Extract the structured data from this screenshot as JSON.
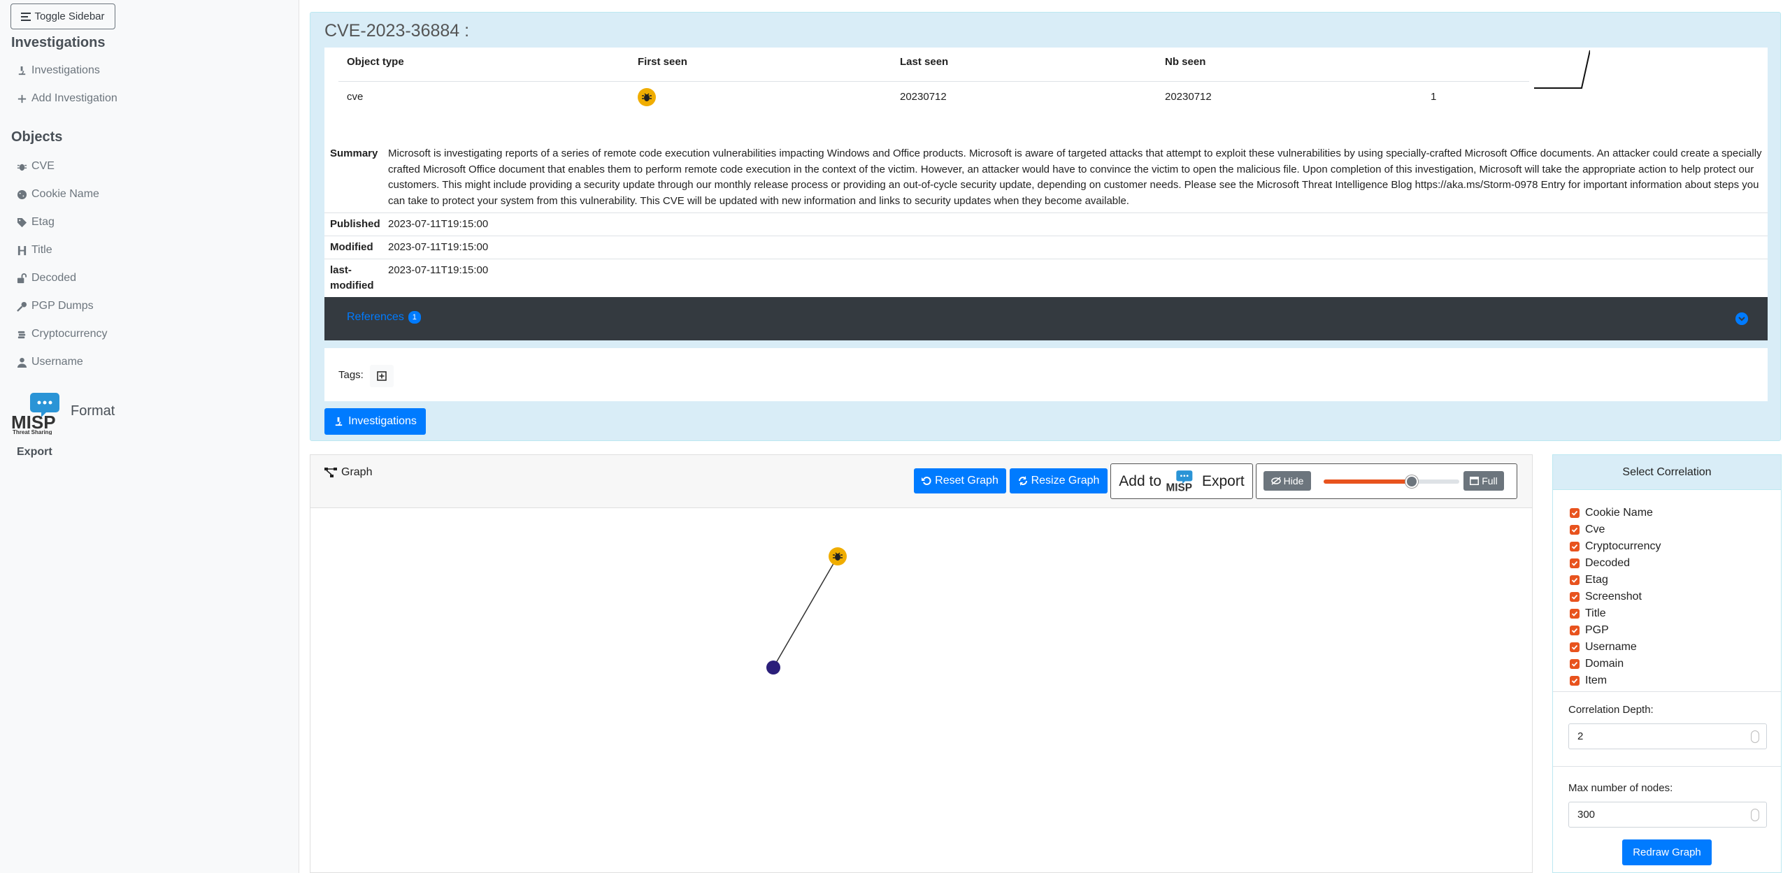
{
  "sidebar": {
    "toggle_label": "Toggle Sidebar",
    "investigations_heading": "Investigations",
    "investigations_link": "Investigations",
    "add_investigation_link": "Add Investigation",
    "objects_heading": "Objects",
    "objects": [
      "CVE",
      "Cookie Name",
      "Etag",
      "Title",
      "Decoded",
      "PGP Dumps",
      "Cryptocurrency",
      "Username"
    ],
    "misp_text": "MISP",
    "misp_sub": "Threat Sharing",
    "format_label": "Format",
    "export_label": "Export"
  },
  "cve": {
    "title": "CVE-2023-36884 :",
    "headers": [
      "Object type",
      "First seen",
      "Last seen",
      "Nb seen"
    ],
    "row": {
      "type": "cve",
      "first_seen": "20230712",
      "last_seen": "20230712",
      "nb_seen": "1"
    },
    "summary_label": "Summary",
    "summary": "Microsoft is investigating reports of a series of remote code execution vulnerabilities impacting Windows and Office products. Microsoft is aware of targeted attacks that attempt to exploit these vulnerabilities by using specially-crafted Microsoft Office documents. An attacker could create a specially crafted Microsoft Office document that enables them to perform remote code execution in the context of the victim. However, an attacker would have to convince the victim to open the malicious file. Upon completion of this investigation, Microsoft will take the appropriate action to help protect our customers. This might include providing a security update through our monthly release process or providing an out-of-cycle security update, depending on customer needs. Please see the Microsoft Threat Intelligence Blog https://aka.ms/Storm-0978  Entry for important information about steps you can take to protect your system from this vulnerability. This CVE will be updated with new information and links to security updates when they become available.",
    "published_label": "Published",
    "published": "2023-07-11T19:15:00",
    "modified_label": "Modified",
    "modified": "2023-07-11T19:15:00",
    "last_modified_label_1": "last-",
    "last_modified_label_2": "modified",
    "last_modified": "2023-07-11T19:15:00",
    "references_label": "References",
    "references_count": "1",
    "tags_label": "Tags:",
    "investigations_button": "Investigations"
  },
  "graph": {
    "title": "Graph",
    "reset_button": "Reset Graph",
    "resize_button": "Resize Graph",
    "add_to_label": "Add to",
    "export_label": "Export",
    "misp_text": "MISP",
    "hide_button": "Hide",
    "full_button": "Full",
    "slider_value": 0.65,
    "node_colors": {
      "cve": "#f0ad00",
      "root": "#2b1f7a"
    }
  },
  "correlation": {
    "title": "Select Correlation",
    "items": [
      "Cookie Name",
      "Cve",
      "Cryptocurrency",
      "Decoded",
      "Etag",
      "Screenshot",
      "Title",
      "PGP",
      "Username",
      "Domain",
      "Item"
    ],
    "depth_label": "Correlation Depth:",
    "depth_value": "2",
    "max_nodes_label": "Max number of nodes:",
    "max_nodes_value": "300",
    "redraw_button": "Redraw Graph"
  },
  "colors": {
    "primary": "#007bff",
    "accent": "#e8531e",
    "panel": "#d9edf7"
  }
}
